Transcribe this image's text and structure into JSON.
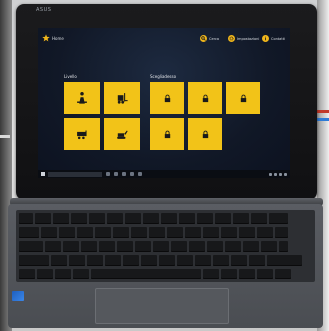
{
  "device": {
    "brand_label": "ASUS"
  },
  "app": {
    "home_label": "Home",
    "header_actions": [
      {
        "label": "Cerca",
        "icon": "search-icon"
      },
      {
        "label": "Impostazioni",
        "icon": "gear-icon"
      },
      {
        "label": "Contatti",
        "icon": "info-icon"
      }
    ],
    "sections": [
      {
        "title": "Livello",
        "tiles": [
          {
            "icon": "person-figure-icon",
            "locked": false
          },
          {
            "icon": "forklift-icon",
            "locked": false
          },
          {
            "icon": "cart-icon",
            "locked": false
          },
          {
            "icon": "excavator-icon",
            "locked": false
          }
        ]
      },
      {
        "title": "Scegliadesso",
        "tiles": [
          {
            "icon": "lock-icon",
            "locked": true
          },
          {
            "icon": "lock-icon",
            "locked": true
          },
          {
            "icon": "lock-icon",
            "locked": true
          },
          {
            "icon": "lock-icon",
            "locked": true
          },
          {
            "icon": "lock-icon",
            "locked": true
          }
        ]
      }
    ]
  },
  "colors": {
    "tile": "#f2c318",
    "accent": "#f0b61b",
    "screen_bg": "#111827"
  }
}
